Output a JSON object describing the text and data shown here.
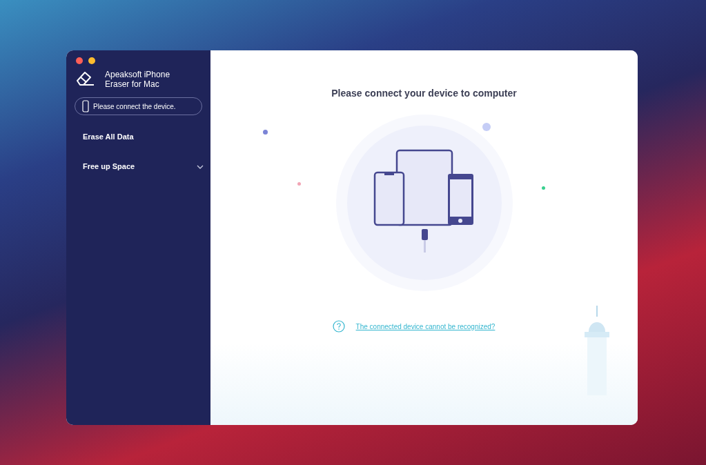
{
  "app": {
    "name": "Apeaksoft iPhone Eraser for Mac"
  },
  "device_status": {
    "text": "Please connect the device."
  },
  "sidebar": {
    "items": [
      {
        "kind": "plain",
        "label": "Erase All Data"
      },
      {
        "kind": "group",
        "label": "Free up Space",
        "expanded": false
      }
    ]
  },
  "main": {
    "heading": "Please connect your device to computer",
    "help_link": "The connected device cannot be recognized?"
  }
}
